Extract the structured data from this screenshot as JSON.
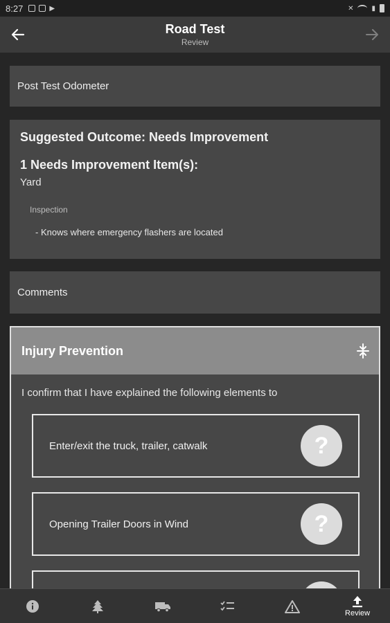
{
  "status_bar": {
    "time": "8:27"
  },
  "app_bar": {
    "title": "Road Test",
    "subtitle": "Review"
  },
  "odometer": {
    "label": "Post Test Odometer"
  },
  "outcome": {
    "heading": "Suggested Outcome: Needs Improvement",
    "count_heading": "1 Needs Improvement Item(s):",
    "category": "Yard",
    "subcategory": "Inspection",
    "item": "- Knows where emergency flashers are located"
  },
  "comments": {
    "label": "Comments"
  },
  "injury_prevention": {
    "title": "Injury Prevention",
    "intro": "I confirm that I have explained the following elements to",
    "items": [
      {
        "label": "Enter/exit the truck, trailer, catwalk",
        "status": "?"
      },
      {
        "label": "Opening Trailer Doors in Wind",
        "status": "?"
      },
      {
        "label": "",
        "status": "?"
      }
    ]
  },
  "bottom_nav": {
    "items": [
      {
        "icon": "info-icon",
        "label": ""
      },
      {
        "icon": "tree-icon",
        "label": ""
      },
      {
        "icon": "truck-icon",
        "label": ""
      },
      {
        "icon": "checklist-icon",
        "label": ""
      },
      {
        "icon": "warning-icon",
        "label": ""
      },
      {
        "icon": "upload-icon",
        "label": "Review"
      }
    ],
    "active_index": 5
  }
}
